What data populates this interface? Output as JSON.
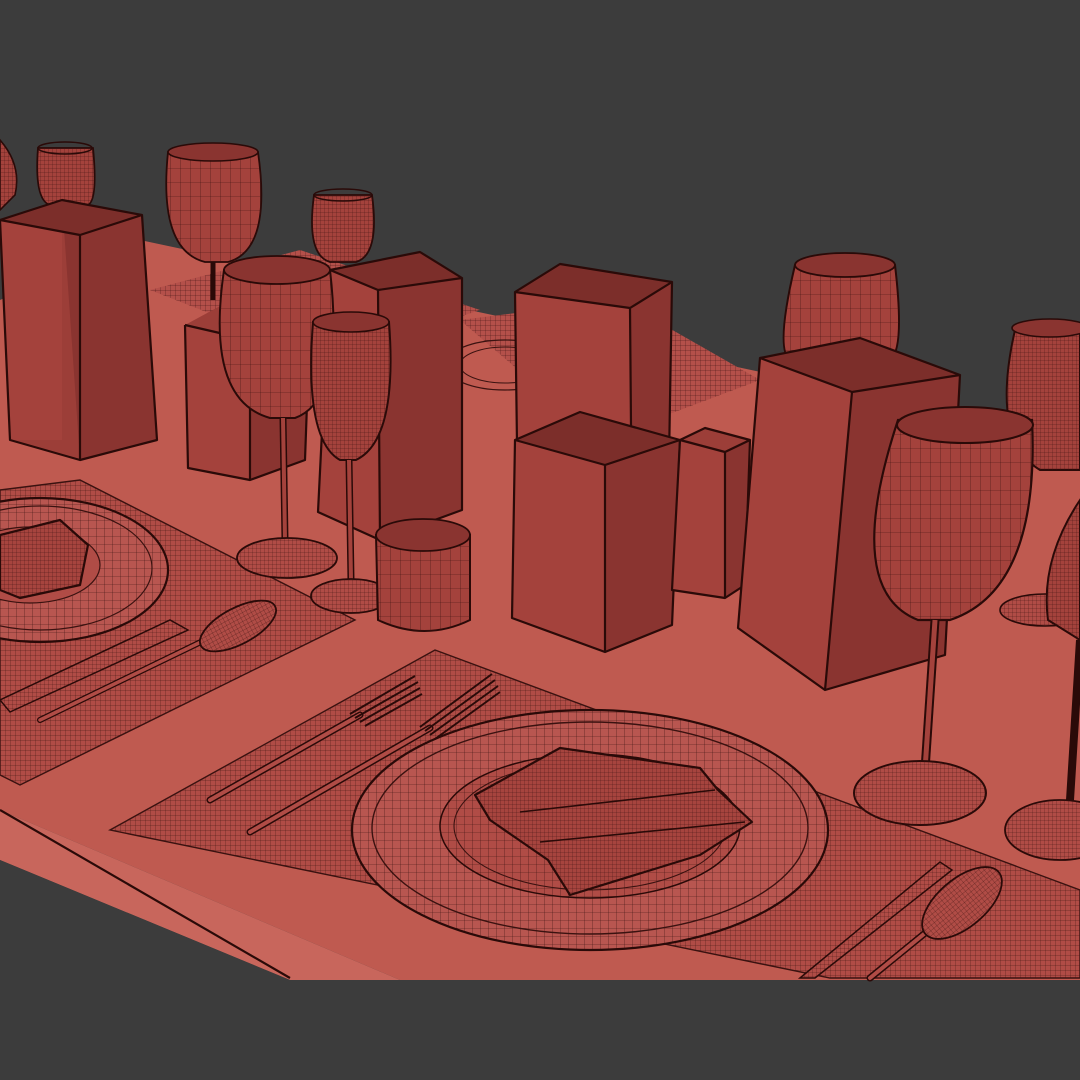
{
  "scene": {
    "background_color": "#3c3c3c",
    "table_color": "#b8524a",
    "object_color": "#9a3e38",
    "wire_color": "#3a1210",
    "render_style": "wireframe-over-shaded"
  }
}
